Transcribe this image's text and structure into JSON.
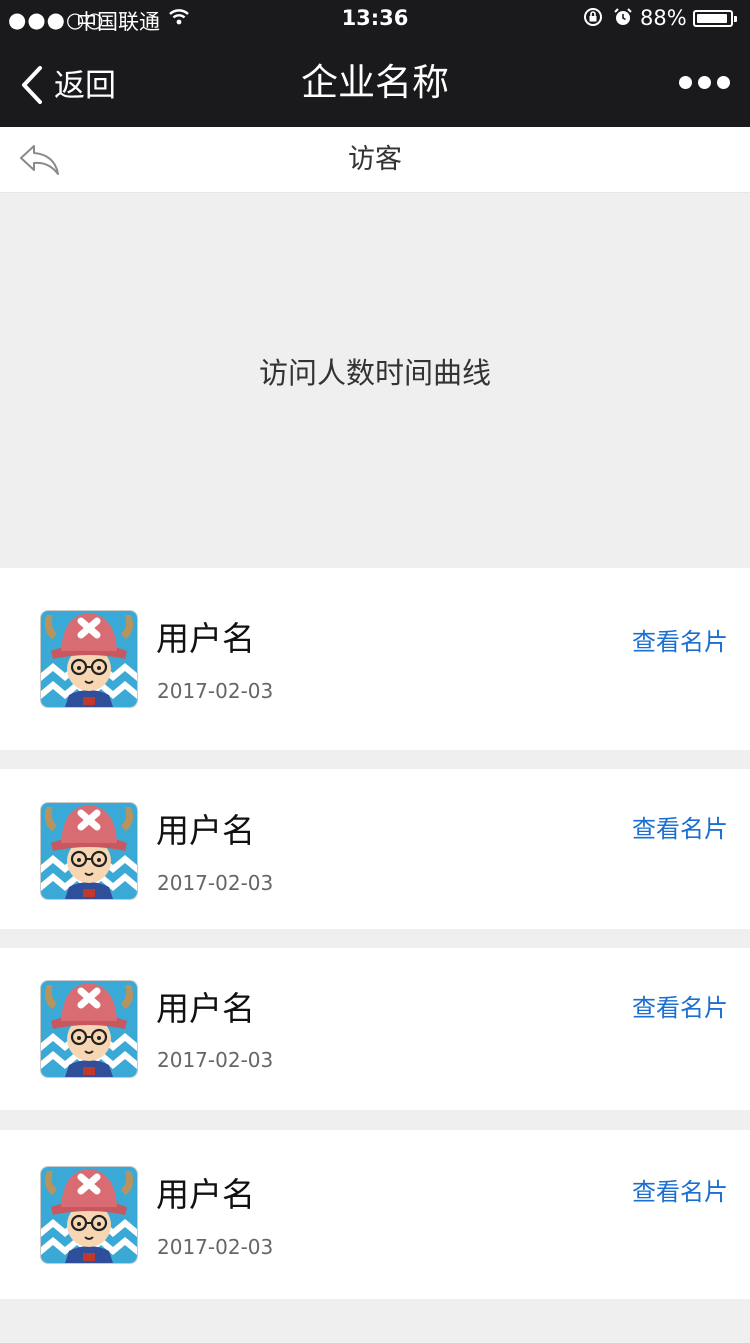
{
  "status_bar": {
    "signal": "●●●○○",
    "carrier": "中国联通",
    "time": "13:36",
    "battery_percent": "88%",
    "battery_level": 0.88,
    "icons": [
      "wifi-icon",
      "rotation-lock-icon",
      "alarm-icon",
      "battery-icon"
    ]
  },
  "nav": {
    "back_label": "返回",
    "title": "企业名称",
    "more_icon": "more-dots-icon"
  },
  "sub_header": {
    "title": "访客",
    "back_icon": "reply-arrow-icon"
  },
  "chart_placeholder": {
    "text": "访问人数时间曲线"
  },
  "visitors": [
    {
      "name": "用户名",
      "date": "2017-02-03",
      "action": "查看名片"
    },
    {
      "name": "用户名",
      "date": "2017-02-03",
      "action": "查看名片"
    },
    {
      "name": "用户名",
      "date": "2017-02-03",
      "action": "查看名片"
    },
    {
      "name": "用户名",
      "date": "2017-02-03",
      "action": "查看名片"
    }
  ],
  "colors": {
    "bar_bg": "#1a1a1c",
    "link": "#1a6fd0",
    "page_bg": "#efefef"
  }
}
